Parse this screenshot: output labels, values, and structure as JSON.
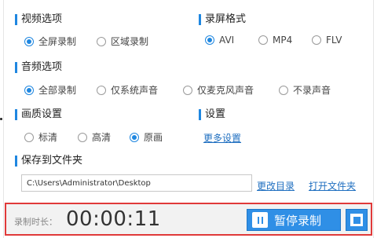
{
  "video": {
    "title": "视频选项",
    "options": [
      {
        "label": "全屏录制",
        "checked": true
      },
      {
        "label": "区域录制",
        "checked": false
      }
    ]
  },
  "format": {
    "title": "录屏格式",
    "options": [
      {
        "label": "AVI",
        "checked": true
      },
      {
        "label": "MP4",
        "checked": false
      },
      {
        "label": "FLV",
        "checked": false
      }
    ]
  },
  "audio": {
    "title": "音频选项",
    "options": [
      {
        "label": "全部录制",
        "checked": true
      },
      {
        "label": "仅系统声音",
        "checked": false
      },
      {
        "label": "仅麦克风声音",
        "checked": false
      },
      {
        "label": "不录声音",
        "checked": false
      }
    ]
  },
  "quality": {
    "title": "画质设置",
    "options": [
      {
        "label": "标清",
        "checked": false
      },
      {
        "label": "高清",
        "checked": false
      },
      {
        "label": "原画",
        "checked": true
      }
    ]
  },
  "settings": {
    "title": "设置",
    "more_link": "更多设置"
  },
  "save": {
    "title": "保存到文件夹",
    "path": "C:\\Users\\Administrator\\Desktop",
    "change_dir_link": "更改目录",
    "open_folder_link": "打开文件夹"
  },
  "recording": {
    "duration_label": "录制时长：",
    "timer": "00:00:11",
    "pause_label": "暂停录制"
  },
  "colors": {
    "accent": "#1f87e0",
    "button": "#2f8fe6",
    "highlight_border": "#e03a3a",
    "link": "#1f6fc0"
  },
  "icons": {
    "pause": "pause-icon",
    "stop": "stop-icon",
    "radio": "radio-icon"
  }
}
